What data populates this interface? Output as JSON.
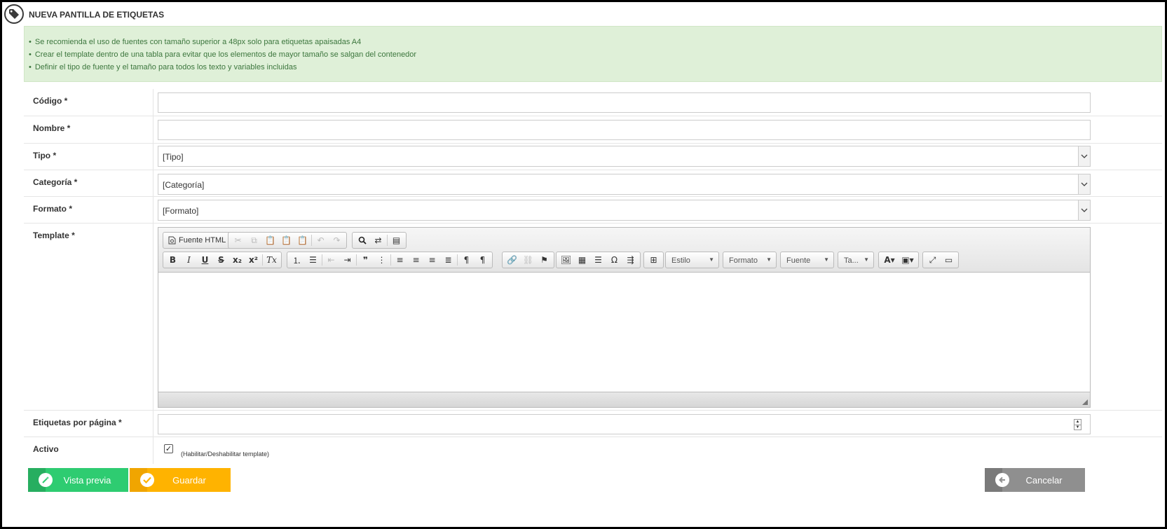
{
  "page": {
    "title": "NUEVA PANTILLA DE ETIQUETAS",
    "icon": "tag-icon"
  },
  "info": {
    "items": [
      "Se recomienda el uso de fuentes con tamaño superior a 48px solo para etiquetas apaisadas A4",
      "Crear el template dentro de una tabla para evitar que los elementos de mayor tamaño se salgan del contenedor",
      "Definir el tipo de fuente y el tamaño para todos los texto y variables incluidas"
    ]
  },
  "form": {
    "codigo": {
      "label": "Código *",
      "value": ""
    },
    "nombre": {
      "label": "Nombre *",
      "value": ""
    },
    "tipo": {
      "label": "Tipo *",
      "value": "[Tipo]"
    },
    "categoria": {
      "label": "Categoría *",
      "value": "[Categoría]"
    },
    "formato": {
      "label": "Formato *",
      "value": "[Formato]"
    },
    "template": {
      "label": "Template *"
    },
    "etiquetas": {
      "label": "Etiquetas por página *",
      "value": ""
    },
    "activo": {
      "label": "Activo",
      "checked": true,
      "hint": "(Habilitar/Deshabilitar template)"
    }
  },
  "editor": {
    "source_label": "Fuente HTML",
    "combos": {
      "estilo": "Estilo",
      "formato": "Formato",
      "fuente": "Fuente",
      "tamano": "Ta..."
    }
  },
  "buttons": {
    "preview": "Vista previa",
    "save": "Guardar",
    "cancel": "Cancelar"
  },
  "colors": {
    "preview": "#2ecc71",
    "save": "#ffb300",
    "cancel": "#8f8f8f",
    "info_bg": "#dff0d8",
    "info_text": "#3c763d"
  }
}
